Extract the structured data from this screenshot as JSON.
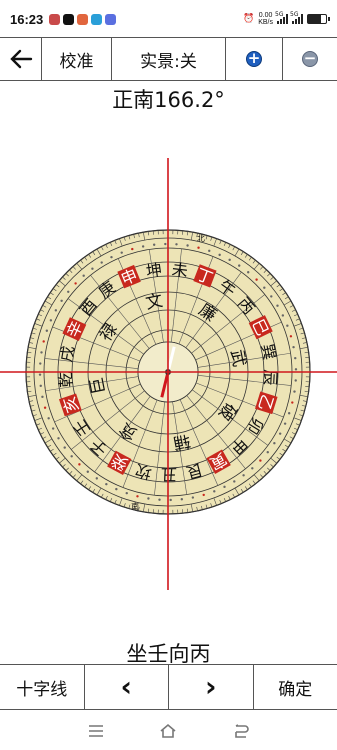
{
  "status_bar": {
    "time": "16:23",
    "net_speed_value": "0.00",
    "net_speed_unit": "KB/s",
    "signal_1_label": "5G",
    "signal_2_label": "5G"
  },
  "toolbar": {
    "calibrate_label": "校准",
    "live_view_label": "实景:关",
    "zoom_in_symbol": "+",
    "zoom_out_symbol": "−"
  },
  "heading_text": "正南166.2°",
  "compass": {
    "rotation_deg": 166.2,
    "ring_chars": [
      "坎",
      "癸",
      "子",
      "壬",
      "亥",
      "乾",
      "戌",
      "辛",
      "酉",
      "庚",
      "申",
      "坤",
      "未",
      "丁",
      "午",
      "丙",
      "巳",
      "巽",
      "辰",
      "乙",
      "卯",
      "甲",
      "寅",
      "艮",
      "丑"
    ],
    "trigrams": [
      "贪",
      "巨",
      "禄",
      "文",
      "廉",
      "武",
      "破",
      "辅"
    ],
    "outer_labels": [
      "北",
      "南"
    ]
  },
  "sit_facing_text": "坐壬向丙",
  "bottom_bar": {
    "crosshair_label": "十字线",
    "prev_symbol": "‹",
    "next_symbol": "›",
    "confirm_label": "确定"
  }
}
